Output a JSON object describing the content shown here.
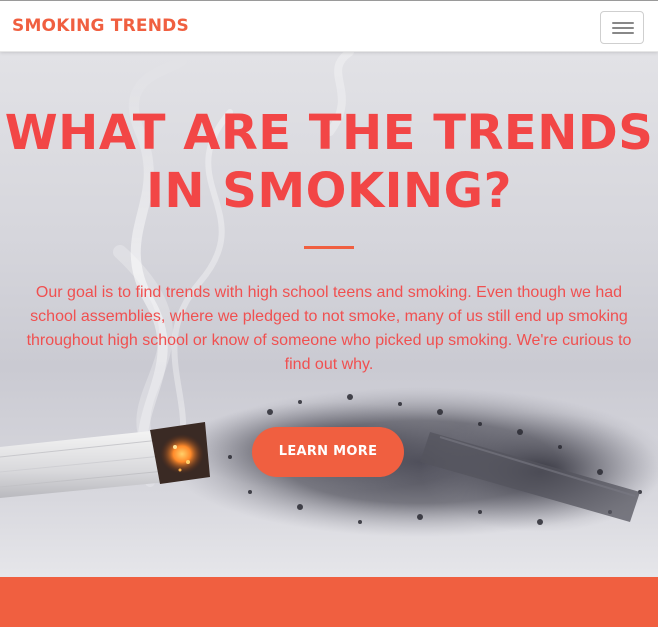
{
  "navbar": {
    "brand": "SMOKING TRENDS",
    "toggle_icon": "hamburger-menu-icon"
  },
  "hero": {
    "title": "WHAT ARE THE TRENDS IN SMOKING?",
    "description": "Our goal is to find trends with high school teens and smoking. Even though we had school assemblies, where we pledged to not smoke, many of us still end up smoking throughout high school or know of someone who picked up smoking. We're curious to find out why.",
    "button_label": "LEARN MORE",
    "background_image": "cigarette-ash-photo"
  },
  "colors": {
    "accent": "#f05f40",
    "title": "#f24646",
    "text": "#f05050",
    "navbar_bg": "#ffffff"
  }
}
